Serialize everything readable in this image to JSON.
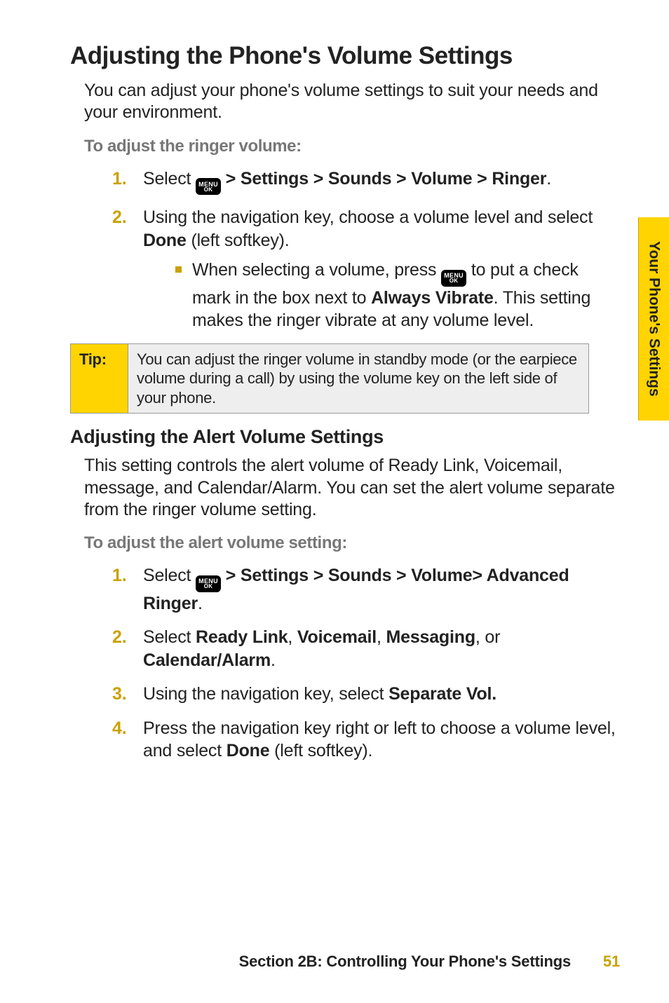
{
  "side_tab": "Your Phone's Settings",
  "h1": "Adjusting the Phone's Volume Settings",
  "intro": "You can adjust your phone's volume settings to suit your needs and your environment.",
  "lead1": "To adjust the ringer volume:",
  "menu_icon": {
    "top": "MENU",
    "bottom": "OK"
  },
  "steps1": [
    {
      "pre": "Select ",
      "post": " > Settings > Sounds > Volume > Ringer",
      "tail": "."
    },
    {
      "pre": "Using the navigation key, choose a volume level and select ",
      "bold1": "Done",
      "post1": " (left softkey).",
      "sub": {
        "pre": "When selecting a volume, press ",
        "mid": " to put a check mark in the box next to ",
        "bold": "Always Vibrate",
        "post": ". This setting makes the ringer vibrate at any volume level."
      }
    }
  ],
  "tip": {
    "label": "Tip:",
    "text": "You can adjust the ringer volume in standby mode (or the earpiece volume during a call) by using the volume key on the left side of your phone."
  },
  "h2": "Adjusting the Alert Volume Settings",
  "intro2": "This setting controls the alert volume of Ready Link, Voicemail, message, and Calendar/Alarm. You can set the alert volume separate from the ringer volume setting.",
  "lead2": "To adjust the alert volume setting:",
  "steps2": [
    {
      "pre": "Select ",
      "post": " > Settings > Sounds > Volume> Advanced Ringer",
      "tail": "."
    },
    {
      "pre": "Select ",
      "b1": "Ready Link",
      "s1": ", ",
      "b2": "Voicemail",
      "s2": ", ",
      "b3": "Messaging",
      "s3": ", or ",
      "b4": "Calendar/Alarm",
      "s4": "."
    },
    {
      "pre": "Using the navigation key, select ",
      "b1": "Separate Vol."
    },
    {
      "pre": "Press the navigation key right or left to choose a volume level, and select ",
      "b1": "Done",
      "post": " (left softkey)."
    }
  ],
  "footer": {
    "section": "Section 2B: Controlling Your Phone's Settings",
    "page": "51"
  }
}
